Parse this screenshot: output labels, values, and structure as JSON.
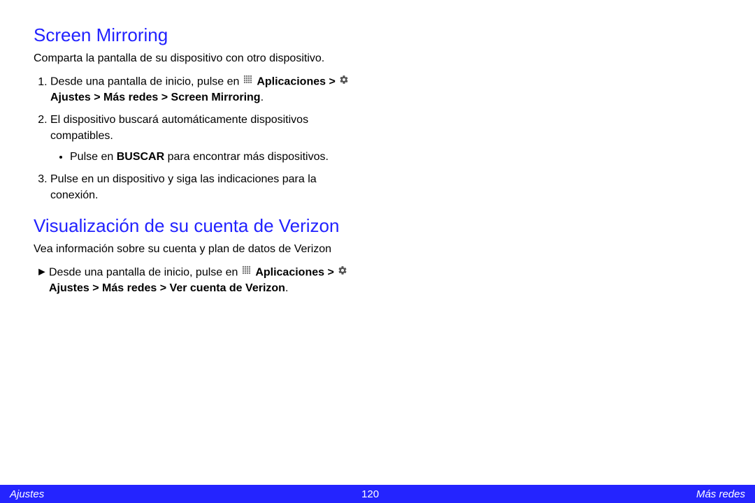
{
  "section1": {
    "title": "Screen Mirroring",
    "intro": "Comparta la pantalla de su dispositivo con otro dispositivo.",
    "steps": {
      "s1_pre": "Desde una pantalla de inicio, pulse en ",
      "s1_apps_label": "Aplicaciones",
      "s1_gt1": " > ",
      "s1_settings_label": " Ajustes > Más redes > Screen Mirroring",
      "s1_period": ".",
      "s2": "El dispositivo buscará automáticamente dispositivos compatibles.",
      "s2_bullet_pre": "Pulse en ",
      "s2_bullet_bold": "BUSCAR",
      "s2_bullet_post": " para encontrar más dispositivos.",
      "s3": "Pulse en un dispositivo y siga las indicaciones para la conexión."
    }
  },
  "section2": {
    "title": "Visualización de su cuenta de Verizon",
    "intro": "Vea información sobre su cuenta y plan de datos de Verizon",
    "arrow": "►",
    "step_pre": "Desde una pantalla de inicio, pulse en ",
    "apps_label": "Aplicaciones",
    "gt1": " > ",
    "settings_label": " Ajustes > Más redes > Ver cuenta de Verizon",
    "period": "."
  },
  "footer": {
    "left": "Ajustes",
    "center": "120",
    "right": "Más redes"
  }
}
